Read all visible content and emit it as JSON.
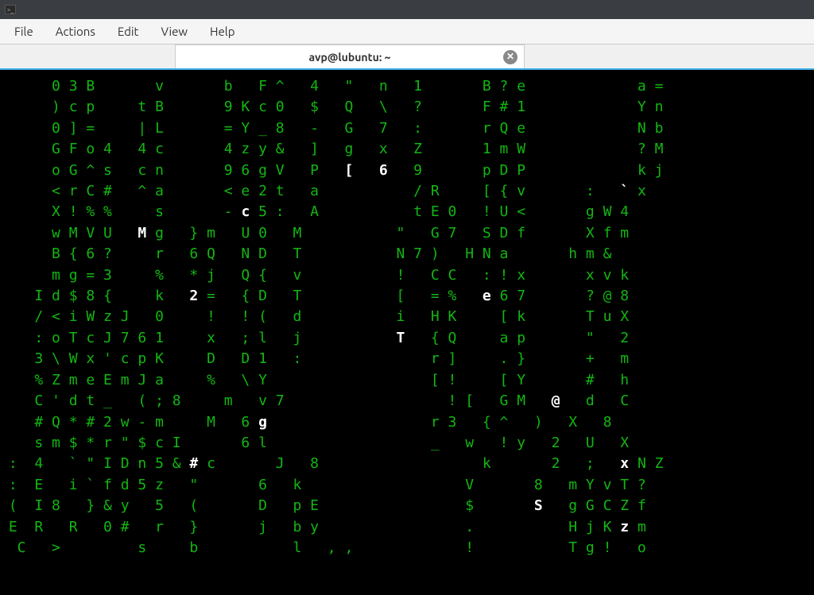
{
  "window": {
    "titlebar_prompt": ">_"
  },
  "menubar": {
    "file": "File",
    "actions": "Actions",
    "edit": "Edit",
    "view": "View",
    "help": "Help"
  },
  "tab": {
    "title": "avp@lubuntu: ~",
    "close": "✕"
  },
  "matrix": {
    "lines": [
      [
        [
          "g",
          "      0 3 B       v       b   F ^   4   \"   n   1       B ? e             a = "
        ]
      ],
      [
        [
          "g",
          "      ) c p     t B       9 K c 0   $   Q   \\   ?       F # 1             Y n "
        ]
      ],
      [
        [
          "g",
          "      0 ] =     | L       = Y _ 8   -   G   7   :       r Q e             N b "
        ]
      ],
      [
        [
          "g",
          "      G F o 4   4 c       4 z y &   ]   g   x   Z       1 m W             ? M "
        ]
      ],
      [
        [
          "g",
          "      o G ^ s   c n       9 6 g V   P   "
        ],
        [
          "wb",
          "[   6"
        ],
        [
          "g",
          "   9       p D P             k j "
        ]
      ],
      [
        [
          "g",
          "      < r C #   ^ a       < e 2 t   a           / R     [ { v       :   "
        ],
        [
          "wb",
          "`"
        ],
        [
          "g",
          " x   "
        ]
      ],
      [
        [
          "g",
          "      X ! % %     s       - "
        ],
        [
          "wb",
          "c"
        ],
        [
          "g",
          " 5 :   A           t E 0   ! U <       g W 4   "
        ]
      ],
      [
        [
          "g",
          "      w M V U   "
        ],
        [
          "wb",
          "M"
        ],
        [
          "g",
          " g   } m   U 0   M           \"   G 7   S D f       X f m   "
        ]
      ],
      [
        [
          "g",
          "      B { 6 ?     r   6 Q   N D   T           N 7 )   H N a       h m &   "
        ]
      ],
      [
        [
          "g",
          "      m g = 3     %   * j   Q {   v           !   C C   : ! x       x v k   "
        ]
      ],
      [
        [
          "g",
          "    I d $ 8 {     k   "
        ],
        [
          "wb",
          "2"
        ],
        [
          "g",
          " =   { D   T           [   = %   "
        ],
        [
          "wb",
          "e"
        ],
        [
          "g",
          " 6 7       ? @ 8   "
        ]
      ],
      [
        [
          "g",
          "    / < i W z J   0     !   ! (   d           i   H K     [ k       T u X   "
        ]
      ],
      [
        [
          "g",
          "    : o T c J 7 6 1     x   ; l   j           "
        ],
        [
          "wb",
          "T"
        ],
        [
          "g",
          "   { Q     a p       \"   2   "
        ]
      ],
      [
        [
          "g",
          "    3 \\ W x ' c p K     D   D 1   :               r ]     . }       +   m   "
        ]
      ],
      [
        [
          "g",
          "    % Z m e E m J a     %   \\ Y                   [ !     [ Y       #   h   "
        ]
      ],
      [
        [
          "g",
          "    C ' d t _   ( ; 8     m   v 7                   ! [   G M   "
        ],
        [
          "wb",
          "@"
        ],
        [
          "g",
          "   d   C   "
        ]
      ],
      [
        [
          "g",
          "    # Q * # 2 w - m     M   6 "
        ],
        [
          "wb",
          "g"
        ],
        [
          "g",
          "                   r 3   { ^   )   X   8   "
        ]
      ],
      [
        [
          "g",
          "    s m $ * r \" $ c I       6 l                   _   w   ! y   2   U   X   "
        ]
      ],
      [
        [
          "g",
          " :  4   ` \" I D n 5 & "
        ],
        [
          "wb",
          "#"
        ],
        [
          "g",
          " c       J   8                   k       2   ;   "
        ],
        [
          "wb",
          "x"
        ],
        [
          "g",
          " N Z   "
        ]
      ],
      [
        [
          "g",
          " :  E   i ` f d 5 z   \"       6   k                   V       8   m Y v T ? "
        ]
      ],
      [
        [
          "g",
          " (  I 8   } & y   5   (       D   p E                 $       "
        ],
        [
          "wb",
          "S"
        ],
        [
          "g",
          "   g G C Z f "
        ]
      ],
      [
        [
          "g",
          " E  R   R   0 #   r   }       j   b y                 .           H j K "
        ],
        [
          "wb",
          "z"
        ],
        [
          "g",
          " m "
        ]
      ],
      [
        [
          "g",
          "  C   >         s     b           l   , ,             !           T g !   o "
        ]
      ]
    ]
  }
}
